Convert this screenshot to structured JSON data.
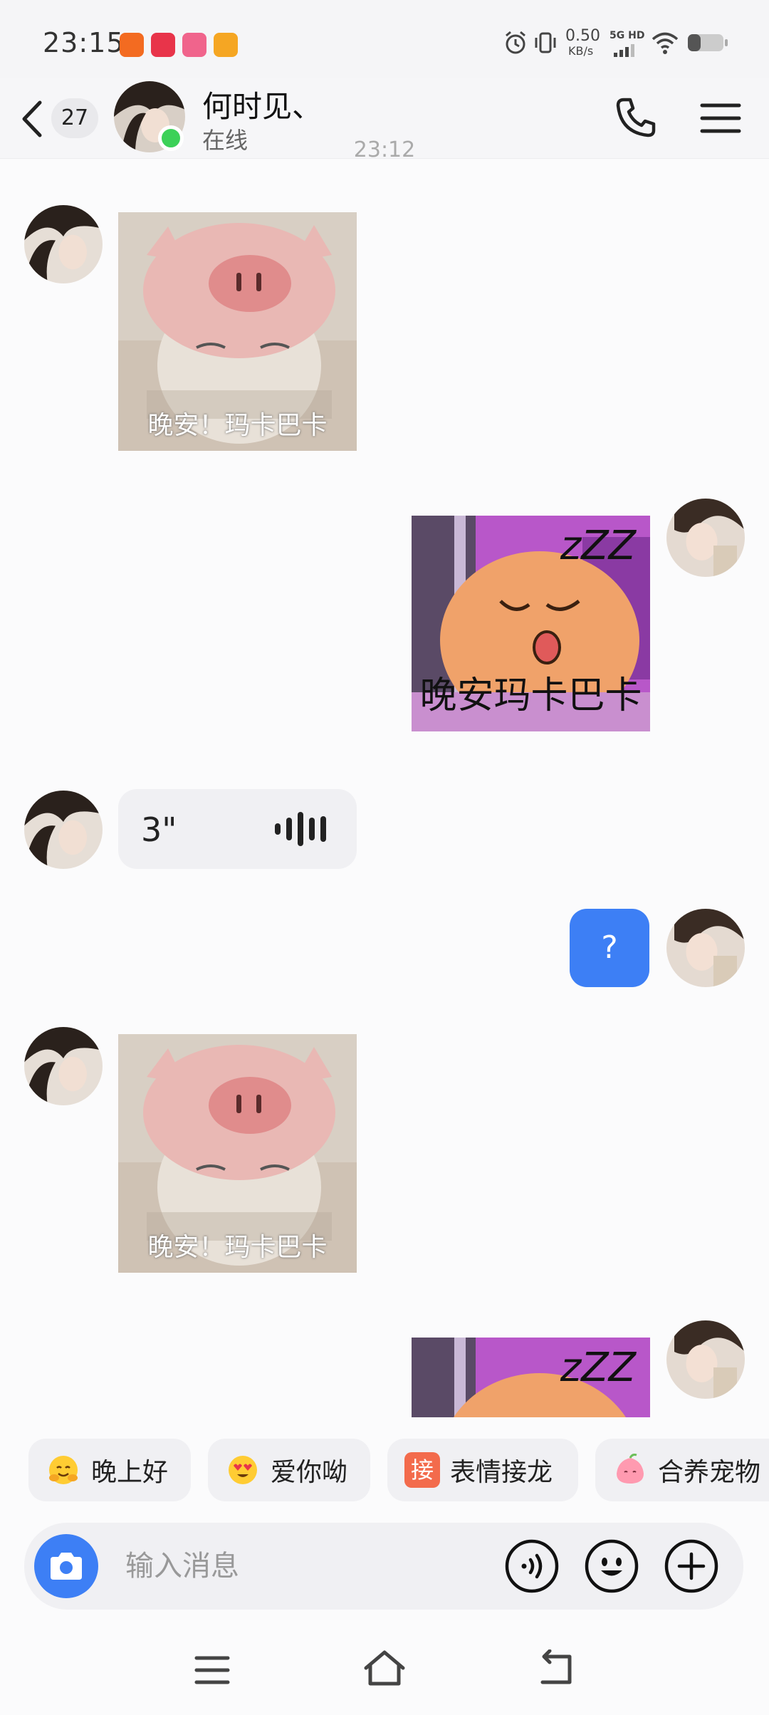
{
  "status_bar": {
    "time": "23:15",
    "net_speed": "0.50",
    "net_unit": "KB/s",
    "network": "5G HD"
  },
  "header": {
    "unread_count": "27",
    "contact_name": "何时见、",
    "contact_status": "在线"
  },
  "chat": {
    "timestamp": "23:12",
    "messages": [
      {
        "side": "left",
        "type": "sticker",
        "caption": "晚安！玛卡巴卡"
      },
      {
        "side": "right",
        "type": "sticker",
        "caption": "晚安玛卡巴卡",
        "zzz": "zZZ"
      },
      {
        "side": "left",
        "type": "voice",
        "duration": "3\""
      },
      {
        "side": "right",
        "type": "text",
        "text": "?"
      },
      {
        "side": "left",
        "type": "sticker",
        "caption": "晚安！玛卡巴卡"
      },
      {
        "side": "right",
        "type": "sticker",
        "zzz": "zZZ"
      }
    ]
  },
  "quick_replies": [
    {
      "label": "晚上好",
      "icon": "hug-emoji-icon"
    },
    {
      "label": "爱你呦",
      "icon": "heart-eyes-emoji-icon"
    },
    {
      "label": "表情接龙",
      "icon": "jie-badge-icon",
      "badge": "接"
    },
    {
      "label": "合养宠物",
      "icon": "pet-peach-icon"
    }
  ],
  "input": {
    "placeholder": "输入消息"
  },
  "colors": {
    "accent": "#3d7ff5",
    "online": "#3cd158",
    "chip_bg": "#f0f0f3",
    "jie_badge": "#f36b4c"
  }
}
